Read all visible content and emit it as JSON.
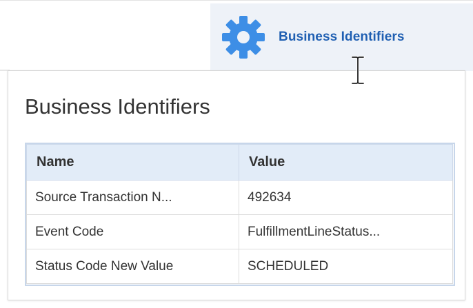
{
  "trigger": {
    "label": "Business Identifiers",
    "icon": "gear-icon",
    "icon_color": "#3d8ee6",
    "text_color": "#1f5fb2",
    "background": "#eef2f8"
  },
  "popup": {
    "title": "Business Identifiers",
    "table": {
      "headers": [
        "Name",
        "Value"
      ],
      "rows": [
        {
          "name": "Source Transaction N...",
          "value": "492634"
        },
        {
          "name": "Event Code",
          "value": "FulfillmentLineStatus..."
        },
        {
          "name": "Status Code New Value",
          "value": "SCHEDULED"
        }
      ]
    }
  },
  "cursor": "ibeam-cursor-icon"
}
